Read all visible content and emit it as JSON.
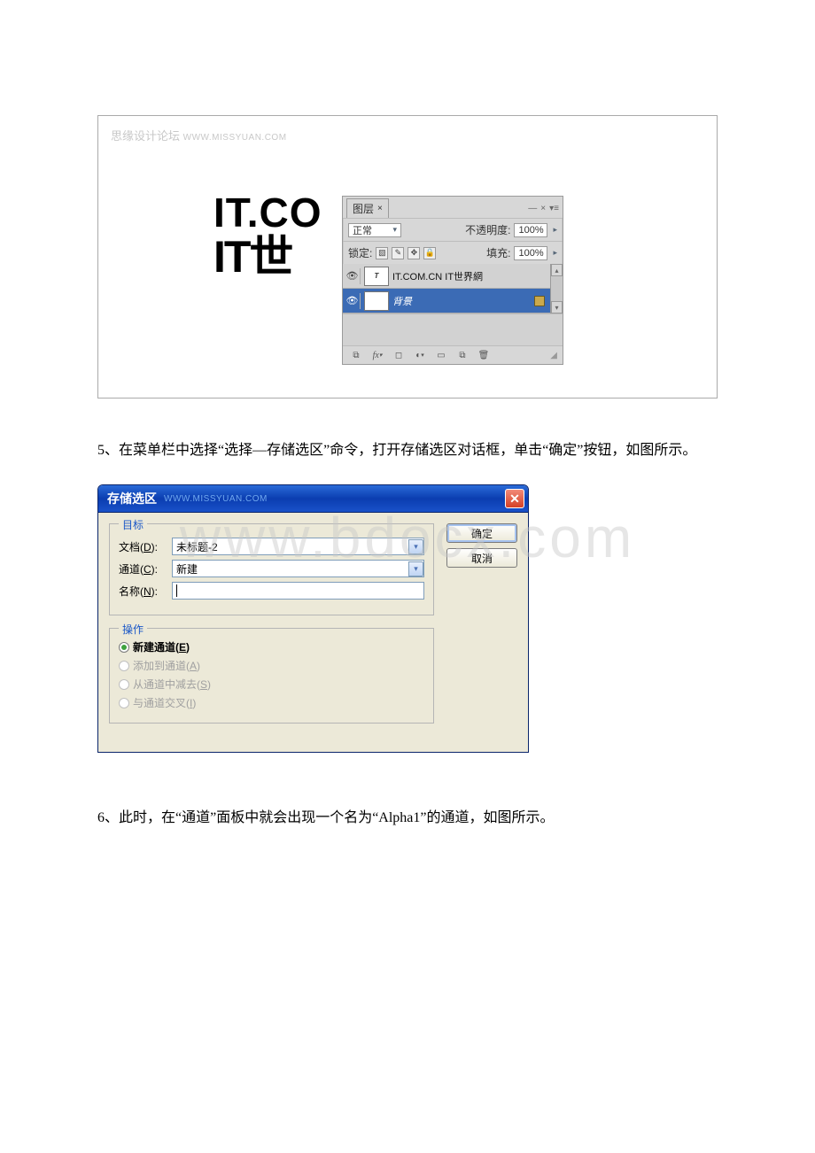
{
  "watermark_main": "www.bdocx.com",
  "fig1": {
    "site_wm_cn": "思缘设计论坛",
    "site_wm_en": "WWW.MISSYUAN.COM",
    "canvas_line1": "IT.CO",
    "canvas_line2": "IT世",
    "panel": {
      "tab": "图层",
      "blend_mode": "正常",
      "opacity_label": "不透明度:",
      "opacity_value": "100%",
      "lock_label": "锁定:",
      "fill_label": "填充:",
      "fill_value": "100%",
      "layer1_name": "IT.COM.CN IT世界網",
      "layer2_name": "背景"
    }
  },
  "para5": "5、在菜单栏中选择“选择—存储选区”命令，打开存储选区对话框，单击“确定”按钮，如图所示。",
  "dialog": {
    "title": "存储选区",
    "title_wm": "WWW.MISSYUAN.COM",
    "ok": "确定",
    "cancel": "取消",
    "group1_legend": "目标",
    "doc_label_pre": "文档(",
    "doc_label_u": "D",
    "doc_label_post": "):",
    "doc_value": "未标题-2",
    "chan_label_pre": "通道(",
    "chan_label_u": "C",
    "chan_label_post": "):",
    "chan_value": "新建",
    "name_label_pre": "名称(",
    "name_label_u": "N",
    "name_label_post": "):",
    "group2_legend": "操作",
    "opt1_pre": "新建通道(",
    "opt1_u": "E",
    "opt1_post": ")",
    "opt2_pre": "添加到通道(",
    "opt2_u": "A",
    "opt2_post": ")",
    "opt3_pre": "从通道中减去(",
    "opt3_u": "S",
    "opt3_post": ")",
    "opt4_pre": "与通道交叉(",
    "opt4_u": "I",
    "opt4_post": ")"
  },
  "para6": "6、此时，在“通道”面板中就会出现一个名为“Alpha1”的通道，如图所示。"
}
